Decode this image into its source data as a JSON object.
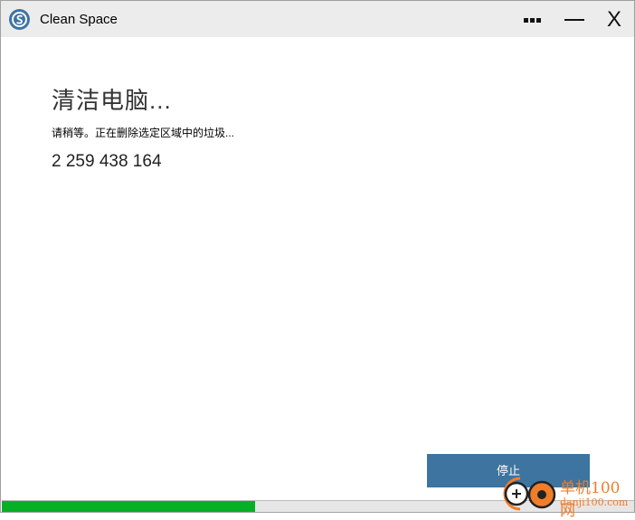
{
  "window": {
    "title": "Clean Space",
    "controls": {
      "more_icon": "more-dots-icon",
      "minimize_icon": "minimize-icon",
      "close_label": "X"
    }
  },
  "main": {
    "heading": "清洁电脑...",
    "status": "请稍等。正在删除选定区域中的垃圾...",
    "count": "2 259 438 164",
    "stop_label": "停止"
  },
  "progress": {
    "percent": 40,
    "color": "#06b025"
  },
  "watermark": {
    "text1": "单机100网",
    "text2": "danji100.com"
  },
  "colors": {
    "accent": "#3e74a0",
    "titlebar": "#ececec"
  }
}
